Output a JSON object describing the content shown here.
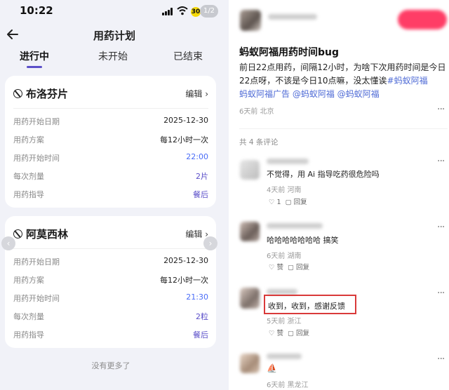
{
  "status": {
    "time": "10:22",
    "battery_badge": "30",
    "page_pill": "1/2"
  },
  "nav": {
    "title": "用药计划"
  },
  "tabs": [
    "进行中",
    "未开始",
    "已结束"
  ],
  "meds": [
    {
      "name": "布洛芬片",
      "edit_label": "编辑 ›",
      "rows": [
        {
          "k": "用药开始日期",
          "v": "2025-12-30"
        },
        {
          "k": "用药方案",
          "v": "每12小时一次"
        },
        {
          "k": "用药开始时间",
          "v": "22:00"
        },
        {
          "k": "每次剂量",
          "v": "2片"
        },
        {
          "k": "用药指导",
          "v": "餐后"
        }
      ]
    },
    {
      "name": "阿莫西林",
      "edit_label": "编辑 ›",
      "rows": [
        {
          "k": "用药开始日期",
          "v": "2025-12-30"
        },
        {
          "k": "用药方案",
          "v": "每12小时一次"
        },
        {
          "k": "用药开始时间",
          "v": "21:30"
        },
        {
          "k": "每次剂量",
          "v": "2粒"
        },
        {
          "k": "用药指导",
          "v": "餐后"
        }
      ]
    }
  ],
  "no_more": "没有更多了",
  "post": {
    "title": "蚂蚁阿福用药时间bug",
    "lines": [
      {
        "text": "前日22点用药，间隔12小时，为啥下次用药时间是今日"
      },
      {
        "text": "22点呀，不该是今日10点嘛，没太懂诶",
        "tag": "#蚂蚁阿福"
      },
      {
        "tag": "蚂蚁阿福广告",
        "mentions": "@蚂蚁阿福 @蚂蚁阿福"
      }
    ],
    "meta": "6天前 北京",
    "comment_count": "共 4 条评论"
  },
  "comments": [
    {
      "text": "不觉得，用 Ai 指导吃药很危险吗",
      "meta": "4天前 河南",
      "like": "♡ 1",
      "reply": "▢ 回复"
    },
    {
      "text": "哈哈哈哈哈哈哈 搞笑",
      "meta": "6天前 湖南",
      "like": "♡ 赞",
      "reply": "▢ 回复"
    },
    {
      "text": "收到，收到，感谢反馈",
      "meta": "5天前 浙江",
      "like": "♡ 赞",
      "reply": "▢ 回复"
    },
    {
      "text": "⛵",
      "meta": "6天前 黑龙江",
      "like": "",
      "reply": ""
    }
  ],
  "colors": {
    "accent": "#5b4fc9",
    "link": "#4f6bd6",
    "follow_button": "#ff3d66",
    "highlight_box": "#d93a3a"
  }
}
